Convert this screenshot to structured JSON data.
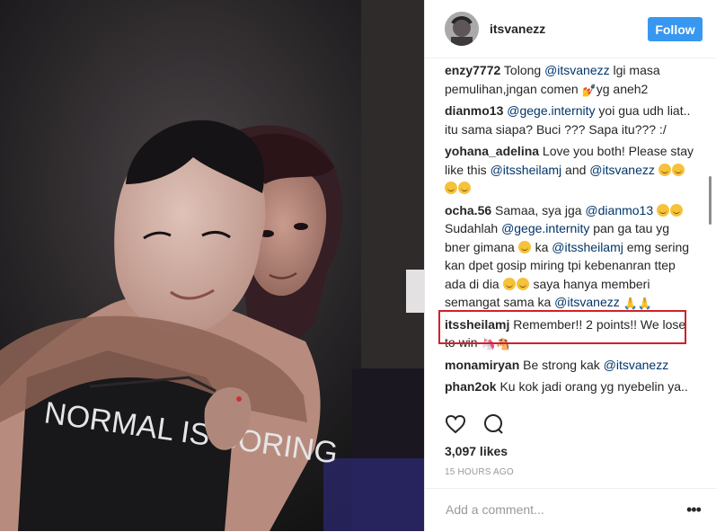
{
  "post": {
    "username": "itsvanezz",
    "follow_label": "Follow",
    "photo_shirt_text": "NORMAL IS BORING",
    "likes": "3,097 likes",
    "timestamp": "15 HOURS AGO",
    "add_comment_placeholder": "Add a comment...",
    "more_options": "•••"
  },
  "comments": [
    {
      "author": "enzy7772",
      "parts": [
        {
          "t": "text",
          "v": " Tolong "
        },
        {
          "t": "mention",
          "v": "@itsvanezz"
        },
        {
          "t": "text",
          "v": " lgi masa pemulihan,jngan comen "
        },
        {
          "t": "emoji",
          "v": "💅"
        },
        {
          "t": "text",
          "v": "yg aneh2"
        }
      ]
    },
    {
      "author": "dianmo13",
      "parts": [
        {
          "t": "text",
          "v": " "
        },
        {
          "t": "mention",
          "v": "@gege.internity"
        },
        {
          "t": "text",
          "v": " yoi gua udh liat.. itu sama siapa? Buci ??? Sapa itu??? :/"
        }
      ]
    },
    {
      "author": "yohana_adelina",
      "parts": [
        {
          "t": "text",
          "v": " Love you both! Please stay like this "
        },
        {
          "t": "mention",
          "v": "@itssheilamj"
        },
        {
          "t": "text",
          "v": " and "
        },
        {
          "t": "mention",
          "v": "@itsvanezz"
        },
        {
          "t": "text",
          "v": " "
        },
        {
          "t": "smiley",
          "v": ""
        },
        {
          "t": "smiley",
          "v": ""
        },
        {
          "t": "smiley",
          "v": ""
        },
        {
          "t": "smiley",
          "v": ""
        }
      ]
    },
    {
      "author": "ocha.56",
      "parts": [
        {
          "t": "text",
          "v": " Samaa, sya jga "
        },
        {
          "t": "mention",
          "v": "@dianmo13"
        },
        {
          "t": "text",
          "v": " "
        },
        {
          "t": "smiley",
          "v": ""
        },
        {
          "t": "smiley",
          "v": ""
        },
        {
          "t": "text",
          "v": " Sudahlah "
        },
        {
          "t": "mention",
          "v": "@gege.internity"
        },
        {
          "t": "text",
          "v": " pan ga tau yg bner gimana "
        },
        {
          "t": "smiley",
          "v": ""
        },
        {
          "t": "text",
          "v": " ka "
        },
        {
          "t": "mention",
          "v": "@itssheilamj"
        },
        {
          "t": "text",
          "v": " emg sering kan dpet gosip miring tpi kebenanran ttep ada di dia "
        },
        {
          "t": "smiley",
          "v": ""
        },
        {
          "t": "smiley",
          "v": ""
        },
        {
          "t": "text",
          "v": " saya hanya memberi semangat sama ka "
        },
        {
          "t": "mention",
          "v": "@itsvanezz"
        },
        {
          "t": "text",
          "v": " "
        },
        {
          "t": "emoji",
          "v": "🙏"
        },
        {
          "t": "emoji",
          "v": "🙏"
        }
      ]
    },
    {
      "author": "itssheilamj",
      "parts": [
        {
          "t": "text",
          "v": " Remember!! 2 points!! We lose to win "
        },
        {
          "t": "emoji",
          "v": "🦄"
        },
        {
          "t": "emoji",
          "v": "🐴"
        }
      ]
    },
    {
      "author": "monamiryan",
      "parts": [
        {
          "t": "text",
          "v": " Be strong kak "
        },
        {
          "t": "mention",
          "v": "@itsvanezz"
        }
      ]
    },
    {
      "author": "phan2ok",
      "parts": [
        {
          "t": "text",
          "v": " Ku kok jadi orang yg nyebelin ya.. Seharian ini ngomel, tapi baru saja lihat"
        }
      ]
    }
  ],
  "icons": {
    "like": "heart-icon",
    "comment": "comment-bubble-icon",
    "avatar": "profile-avatar"
  },
  "colors": {
    "follow_button": "#3897f0",
    "mention": "#003569",
    "highlight_box": "#d32027",
    "muted_text": "#999999"
  }
}
